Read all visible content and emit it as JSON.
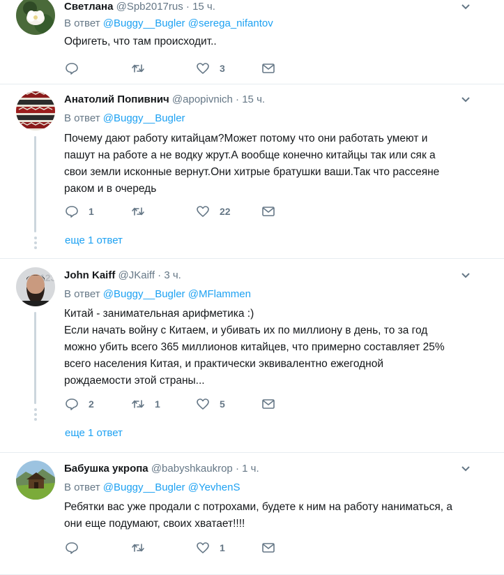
{
  "tweets": [
    {
      "name": "Светлана",
      "handle": "@Spb2017rus",
      "time": "15 ч.",
      "reply_prefix": "В ответ",
      "mentions": [
        "@Buggy__Bugler",
        "@serega_nifantov"
      ],
      "text": [
        "Офигеть, что там происходит.."
      ],
      "replies": "",
      "retweets": "",
      "likes": "3"
    },
    {
      "name": "Анатолий Попивнич",
      "handle": "@apopivnich",
      "time": "15 ч.",
      "reply_prefix": "В ответ",
      "mentions": [
        "@Buggy__Bugler"
      ],
      "text": [
        "Почему дают работу китайцам?Может потому что они работать умеют и",
        "пашут на работе а не водку жрут.А вообще конечно китайцы так или сяк а",
        "свои земли исконные вернут.Они хитрые братушки ваши.Так что рассеяне",
        "раком и в очередь"
      ],
      "replies": "1",
      "retweets": "",
      "likes": "22",
      "more": "еще 1 ответ"
    },
    {
      "name": "John Kaiff",
      "handle": "@JKaiff",
      "time": "3 ч.",
      "reply_prefix": "В ответ",
      "mentions": [
        "@Buggy__Bugler",
        "@MFlammen"
      ],
      "text": [
        "Китай - занимательная арифметика :)",
        "Если начать войну с Китаем, и убивать их по миллиону в день, то за год",
        "можно убить всего 365 миллионов китайцев, что примерно составляет 25%",
        "всего населения Китая, и практически эквивалентно ежегодной",
        "рождаемости этой страны..."
      ],
      "replies": "2",
      "retweets": "1",
      "likes": "5",
      "more": "еще 1 ответ"
    },
    {
      "name": "Бабушка укропа",
      "handle": "@babyshkaukrop",
      "time": "1 ч.",
      "reply_prefix": "В ответ",
      "mentions": [
        "@Buggy__Bugler",
        "@YevhenS"
      ],
      "text": [
        "Ребятки вас уже продали с потрохами, будете к ним на работу наниматься, а",
        "они еще подумают, своих хватает!!!!"
      ],
      "replies": "",
      "retweets": "",
      "likes": "1"
    }
  ],
  "colors": {
    "link": "#1da1f2",
    "muted": "#657786",
    "text": "#14171a",
    "border": "#e6ecf0"
  },
  "icons": [
    "reply-icon",
    "retweet-icon",
    "like-icon",
    "dm-icon",
    "chevron-down-icon"
  ]
}
